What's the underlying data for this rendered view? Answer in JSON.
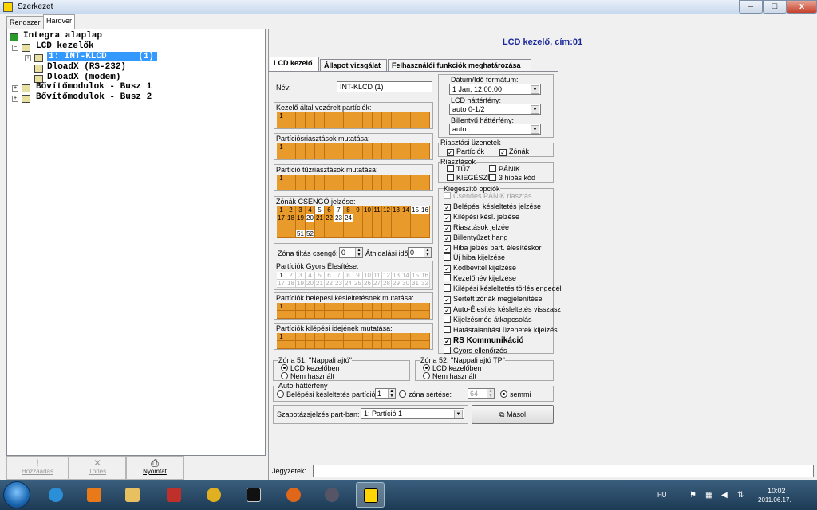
{
  "window": {
    "title": "Szerkezet",
    "min": "–",
    "max": "□",
    "close": "x"
  },
  "left_tabs": [
    "Rendszer",
    "Hardver"
  ],
  "tree": {
    "root": "Integra alaplap",
    "lcd": "LCD kezelők",
    "item1": "1: INT-KLCD      (1)",
    "dload_rs": "DloadX (RS-232)",
    "dload_modem": "DloadX (modem)",
    "bus1": "Bővítőmodulok - Busz 1",
    "bus2": "Bővítőmodulok - Busz 2"
  },
  "left_buttons": {
    "add": "Hozzáadás",
    "delete": "Törlés",
    "print": "Nyomtat"
  },
  "panel_title": "LCD kezelő, cím:01",
  "tabs": [
    "LCD kezelő",
    "Állapot vizsgálat",
    "Felhasználói funkciók meghatározása"
  ],
  "name_label": "Név:",
  "name_value": "INT-KLCD    (1)",
  "grids": {
    "g1": "Kezelő által vezérelt partíciók:",
    "g2": "Partíciósriasztások mutatása:",
    "g3": "Partíció tűzriasztások mutatása:",
    "zones": "Zónák CSENGŐ jelzése:",
    "g5": "Partíciók Gyors Élesítése:",
    "g6": "Partíciók belépési késleltetésnek mutatása:",
    "g7": "Partíciók kilépési idejének mutatása:"
  },
  "grid_first": "1",
  "zone_cells": {
    "row1": [
      "1",
      "2",
      "3",
      "4",
      "5",
      "6",
      "7",
      "8",
      "9",
      "10",
      "11",
      "12",
      "13",
      "14",
      "15",
      "16"
    ],
    "row2": [
      "17",
      "18",
      "19",
      "20",
      "21",
      "22",
      "23",
      "24"
    ],
    "extra": [
      "51",
      "52"
    ]
  },
  "fast_arm_row1": [
    "1",
    "2",
    "3",
    "4",
    "5",
    "6",
    "7",
    "8",
    "9",
    "10",
    "11",
    "12",
    "13",
    "14",
    "15",
    "16"
  ],
  "fast_arm_row2": [
    "17",
    "18",
    "19",
    "20",
    "21",
    "22",
    "23",
    "24",
    "25",
    "26",
    "27",
    "28",
    "29",
    "30",
    "31",
    "32"
  ],
  "zone_mute": {
    "label": "Zóna tiltás csengő:",
    "value": "0"
  },
  "bypass": {
    "label": "Áthidalási idő:",
    "value": "0"
  },
  "datetime": {
    "label": "Dátum/Idő formátum:",
    "value": "1 Jan, 12:00:00"
  },
  "lcd_backlight": {
    "label": "LCD háttérfény:",
    "value": "auto 0-1/2"
  },
  "key_backlight": {
    "label": "Billentyű háttérfény:",
    "value": "auto"
  },
  "alarm_msgs": {
    "title": "Riasztási üzenetek",
    "partitions": "Partíciók",
    "zones": "Zónák"
  },
  "alarms": {
    "title": "Riasztások",
    "fire": "TŰZ",
    "panic": "PÁNIK",
    "aux": "KIEGÉSZÍ",
    "code3": "3 hibás kód"
  },
  "extra_opts": {
    "title": "Kiegészítő opciók",
    "items": [
      {
        "label": "Csendes PÁNIK riasztás",
        "checked": false,
        "disabled": true
      },
      {
        "label": "Belépési késleltetés jelzése",
        "checked": true
      },
      {
        "label": "Kilépési késl. jelzése",
        "checked": true
      },
      {
        "label": "Riasztások jelzée",
        "checked": true
      },
      {
        "label": "Billentyűzet hang",
        "checked": true
      },
      {
        "label": "Hiba jelzés part. élesítéskor",
        "checked": true
      },
      {
        "label": "Új hiba kijelzése",
        "checked": false
      },
      {
        "label": "Kódbevitel kijelzése",
        "checked": true
      },
      {
        "label": "Kezelőnév kijelzése",
        "checked": false
      },
      {
        "label": "Kilépési késleltetés törlés engedél",
        "checked": false
      },
      {
        "label": "Sértett zónák megjelenítése",
        "checked": true
      },
      {
        "label": "Auto-Élesítés késleltetés visszasz",
        "checked": true
      },
      {
        "label": "Kijelzésmód átkapcsolás",
        "checked": false
      },
      {
        "label": "Hatástalanítási üzenetek kijelzés",
        "checked": false
      },
      {
        "label": "RS Kommunikáció",
        "checked": true,
        "big": true
      },
      {
        "label": "Gyors ellenőrzés",
        "checked": false
      }
    ]
  },
  "zone51": {
    "title": "Zóna 51: \"Nappali ajtó\"",
    "opt1": "LCD kezelőben",
    "opt2": "Nem használt"
  },
  "zone52": {
    "title": "Zóna 52: \"Nappali ajtó TP\"",
    "opt1": "LCD kezelőben",
    "opt2": "Nem használt"
  },
  "auto_backlight": {
    "title": "Auto-háttérfény",
    "entry": "Belépési késleltetés partíciób",
    "entry_val": "1",
    "zone": "zóna sértése:",
    "zone_val": "64",
    "none": "semmi"
  },
  "tamper": {
    "label": "Szabotázsjelzés part-ban:",
    "value": "1: Partíció  1"
  },
  "copy_btn": "Másol",
  "notes_label": "Jegyzetek:",
  "taskbar": {
    "lang": "HU",
    "time": "10:02",
    "date": "2011.06.17."
  }
}
